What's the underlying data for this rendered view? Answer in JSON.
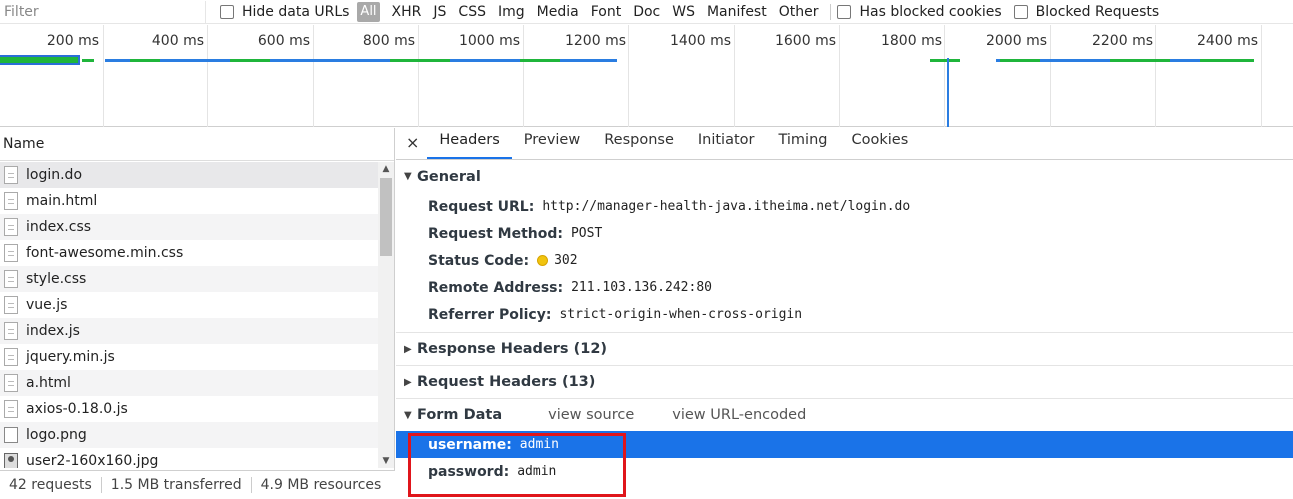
{
  "filter": {
    "placeholder": "Filter",
    "hide_data_urls": "Hide data URLs",
    "types": [
      "All",
      "XHR",
      "JS",
      "CSS",
      "Img",
      "Media",
      "Font",
      "Doc",
      "WS",
      "Manifest",
      "Other"
    ],
    "has_blocked_cookies": "Has blocked cookies",
    "blocked_requests": "Blocked Requests"
  },
  "timeline": {
    "ticks": [
      "200 ms",
      "400 ms",
      "600 ms",
      "800 ms",
      "1000 ms",
      "1200 ms",
      "1400 ms",
      "1600 ms",
      "1800 ms",
      "2000 ms",
      "2200 ms",
      "2400 ms"
    ]
  },
  "list": {
    "header": "Name",
    "rows": [
      {
        "name": "login.do",
        "icon": "document-icon"
      },
      {
        "name": "main.html",
        "icon": "document-icon"
      },
      {
        "name": "index.css",
        "icon": "document-icon"
      },
      {
        "name": "font-awesome.min.css",
        "icon": "document-icon"
      },
      {
        "name": "style.css",
        "icon": "document-icon"
      },
      {
        "name": "vue.js",
        "icon": "document-icon"
      },
      {
        "name": "index.js",
        "icon": "document-icon"
      },
      {
        "name": "jquery.min.js",
        "icon": "document-icon"
      },
      {
        "name": "a.html",
        "icon": "document-icon"
      },
      {
        "name": "axios-0.18.0.js",
        "icon": "document-icon"
      },
      {
        "name": "logo.png",
        "icon": "image-icon"
      },
      {
        "name": "user2-160x160.jpg",
        "icon": "user-image-icon"
      }
    ],
    "status": {
      "requests": "42 requests",
      "transferred": "1.5 MB transferred",
      "resources": "4.9 MB resources"
    }
  },
  "details": {
    "close": "×",
    "tabs": [
      "Headers",
      "Preview",
      "Response",
      "Initiator",
      "Timing",
      "Cookies"
    ],
    "general": {
      "title": "General",
      "rows": [
        {
          "name": "Request URL:",
          "value": "http://manager-health-java.itheima.net/login.do"
        },
        {
          "name": "Request Method:",
          "value": "POST"
        },
        {
          "name": "Status Code:",
          "value": "302"
        },
        {
          "name": "Remote Address:",
          "value": "211.103.136.242:80"
        },
        {
          "name": "Referrer Policy:",
          "value": "strict-origin-when-cross-origin"
        }
      ]
    },
    "response_headers": "Response Headers (12)",
    "request_headers": "Request Headers (13)",
    "form_data": {
      "title": "Form Data",
      "view_source": "view source",
      "view_url_encoded": "view URL-encoded",
      "rows": [
        {
          "name": "username:",
          "value": "admin"
        },
        {
          "name": "password:",
          "value": "admin"
        }
      ]
    }
  },
  "colors": {
    "accent": "#1a73e8",
    "highlight_box": "#e0151b",
    "status_dot": "#f1c40f"
  }
}
